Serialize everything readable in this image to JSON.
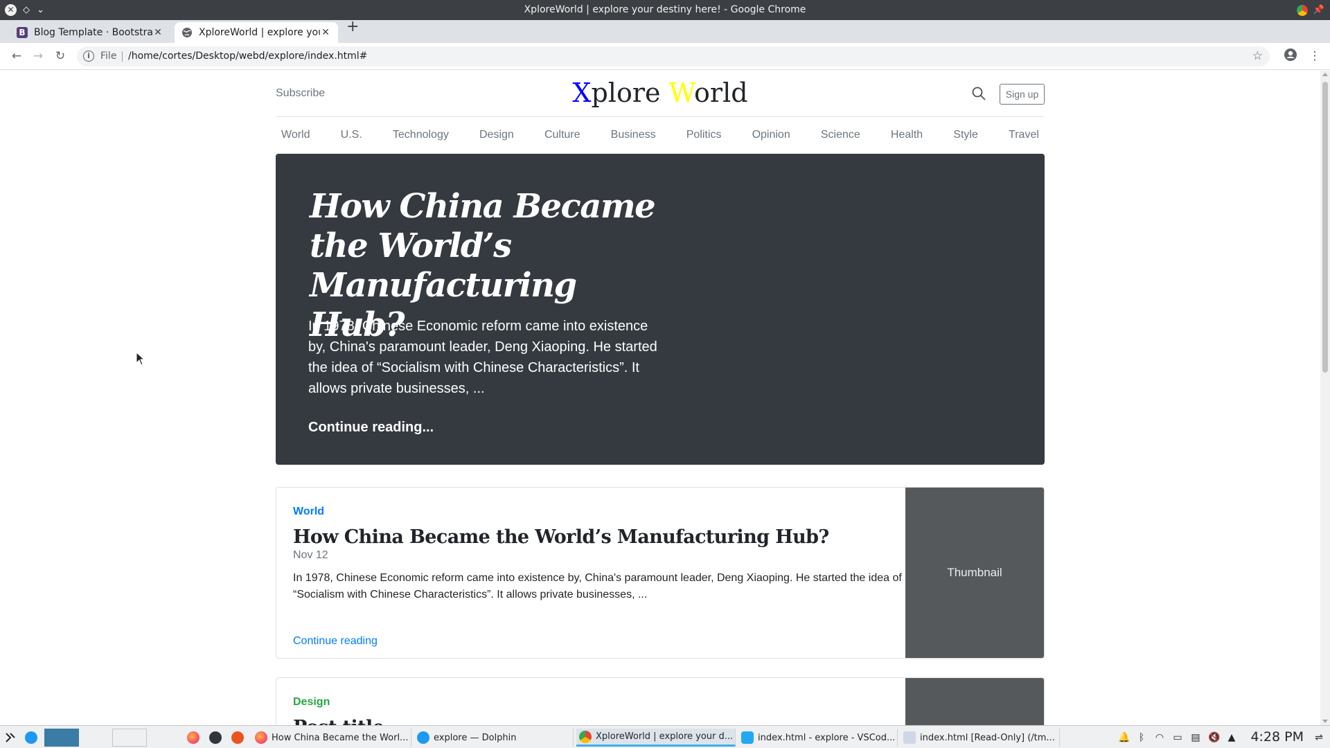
{
  "window": {
    "title": "XploreWorld | explore your destiny here! - Google Chrome"
  },
  "tabs": [
    {
      "label": "Blog Template · Bootstrap",
      "favicon": "bootstrap-icon",
      "active": false
    },
    {
      "label": "XploreWorld | explore your",
      "favicon": "globe-icon",
      "active": true
    }
  ],
  "address_bar": {
    "scheme": "File",
    "url": "/home/cortes/Desktop/webd/explore/index.html#"
  },
  "header": {
    "subscribe": "Subscribe",
    "logo_x": "X",
    "logo_plore": "plore ",
    "logo_w": "W",
    "logo_orld": "orld",
    "signup": "Sign up"
  },
  "nav": [
    "World",
    "U.S.",
    "Technology",
    "Design",
    "Culture",
    "Business",
    "Politics",
    "Opinion",
    "Science",
    "Health",
    "Style",
    "Travel"
  ],
  "hero": {
    "title": "How China Became the World’s Manufacturing Hub?",
    "lead": "In 1978, Chinese Economic reform came into existence by, China's paramount leader, Deng Xiaoping. He started the idea of “Socialism with Chinese Characteristics”. It allows private businesses, ...",
    "cta": "Continue reading..."
  },
  "posts": [
    {
      "category": "World",
      "category_color": "#007bff",
      "title": "How China Became the World’s Manufacturing Hub?",
      "date": "Nov 12",
      "excerpt": "In 1978, Chinese Economic reform came into existence by, China's paramount leader, Deng Xiaoping. He started the idea of “Socialism with Chinese Characteristics”. It allows private businesses, ...",
      "link": "Continue reading",
      "thumbnail": "Thumbnail"
    },
    {
      "category": "Design",
      "category_color": "#28a745",
      "title": "Post title"
    }
  ],
  "taskbar": {
    "tasks": [
      {
        "label": "How China Became the Worl...",
        "icon": "firefox-icon"
      },
      {
        "label": "explore — Dolphin",
        "icon": "dolphin-icon"
      },
      {
        "label": "XploreWorld | explore your d...",
        "icon": "chrome-icon",
        "active": true
      },
      {
        "label": "index.html - explore - VSCod...",
        "icon": "vscode-icon"
      },
      {
        "label": "index.html [Read-Only] (/tm...",
        "icon": "kate-icon"
      }
    ],
    "clock": "4:28 PM"
  }
}
